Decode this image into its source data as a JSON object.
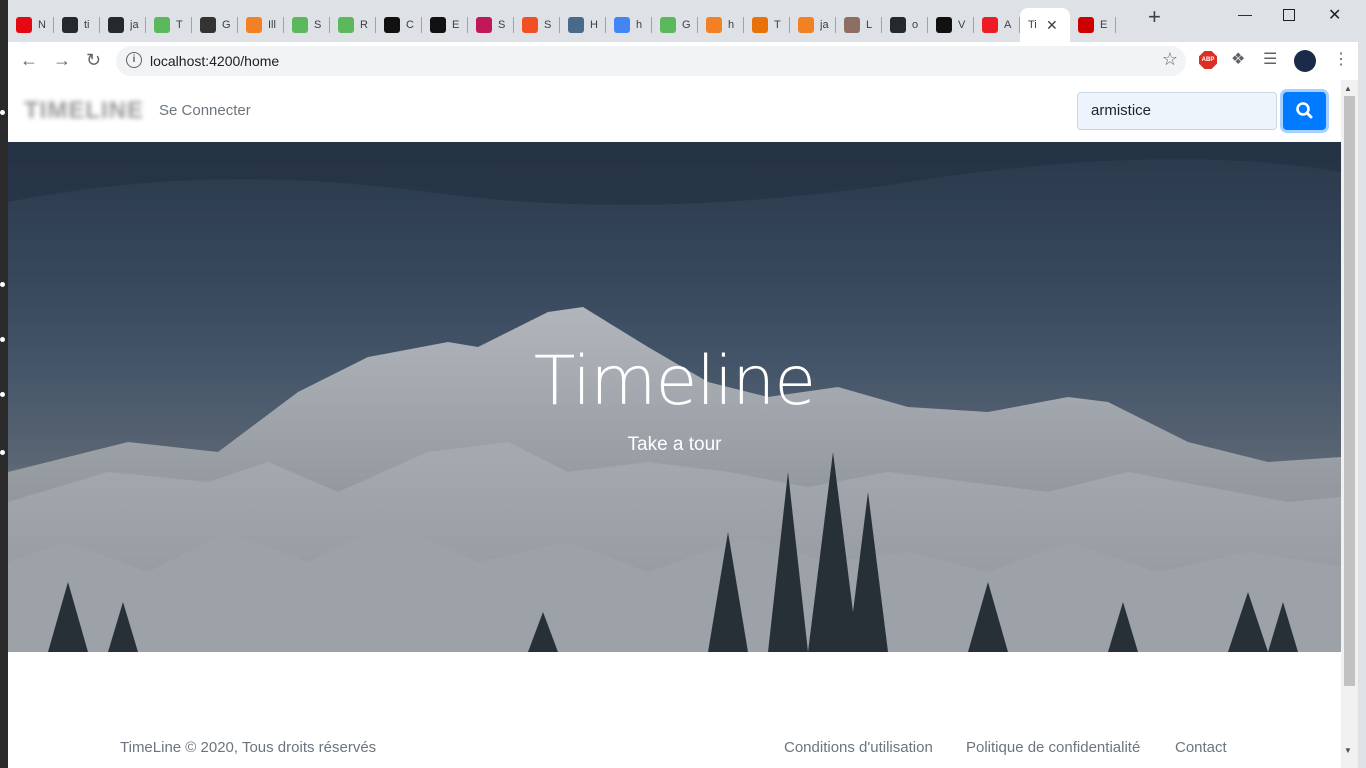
{
  "browser": {
    "tabs": [
      {
        "title": "N",
        "favicon_color": "#e50914"
      },
      {
        "title": "ti",
        "favicon_color": "#24292e"
      },
      {
        "title": "ja",
        "favicon_color": "#24292e"
      },
      {
        "title": "T",
        "favicon_color": "#5cb85c"
      },
      {
        "title": "G",
        "favicon_color": "#333333"
      },
      {
        "title": "Ill",
        "favicon_color": "#f48024"
      },
      {
        "title": "S",
        "favicon_color": "#5cb85c"
      },
      {
        "title": "R",
        "favicon_color": "#5cb85c"
      },
      {
        "title": "C",
        "favicon_color": "#111111"
      },
      {
        "title": "E",
        "favicon_color": "#111111"
      },
      {
        "title": "S",
        "favicon_color": "#c2185b"
      },
      {
        "title": "S",
        "favicon_color": "#f25022"
      },
      {
        "title": "H",
        "favicon_color": "#4a6a8a"
      },
      {
        "title": "h",
        "favicon_color": "#4285f4"
      },
      {
        "title": "G",
        "favicon_color": "#5cb85c"
      },
      {
        "title": "h",
        "favicon_color": "#f48024"
      },
      {
        "title": "T",
        "favicon_color": "#e8710a"
      },
      {
        "title": "ja",
        "favicon_color": "#f48024"
      },
      {
        "title": "L",
        "favicon_color": "#8d6e63"
      },
      {
        "title": "o",
        "favicon_color": "#24292e"
      },
      {
        "title": "V",
        "favicon_color": "#111111"
      },
      {
        "title": "A",
        "favicon_color": "#ed1c24"
      },
      {
        "title": "Ti",
        "favicon_color": "#ffffff",
        "active": true
      },
      {
        "title": "E",
        "favicon_color": "#cc0000"
      }
    ],
    "url": "localhost:4200/home",
    "new_tab_label": "+",
    "close_tab_label": "✕",
    "abp_label": "ABP"
  },
  "navbar": {
    "brand": "TIMELINE",
    "login_link": "Se Connecter",
    "search_value": "armistice"
  },
  "hero": {
    "title": "Timeline",
    "subtitle": "Take a tour"
  },
  "footer": {
    "copyright": "TimeLine © 2020, Tous droits réservés",
    "links": [
      "Conditions d'utilisation",
      "Politique de confidentialité",
      "Contact"
    ]
  },
  "colors": {
    "primary": "#007bff",
    "muted": "#6c757d"
  }
}
